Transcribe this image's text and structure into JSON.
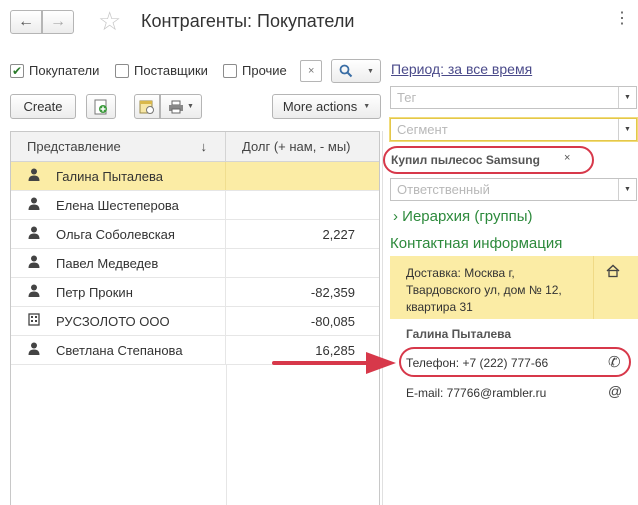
{
  "header": {
    "back_icon": "arrow-left-icon",
    "forward_icon": "arrow-right-icon",
    "star_icon": "star-icon",
    "title": "Контрагенты: Покупатели",
    "more_icon": "more-menu-icon"
  },
  "filters": {
    "buyers": {
      "label": "Покупатели",
      "checked": true
    },
    "suppliers": {
      "label": "Поставщики",
      "checked": false
    },
    "other": {
      "label": "Прочие",
      "checked": false
    },
    "clear_glyph": "×"
  },
  "toolbar": {
    "create_label": "Create",
    "more_actions_label": "More actions"
  },
  "table": {
    "columns": [
      "Представление",
      "Долг (+ нам, - мы)"
    ],
    "sort_glyph": "↓",
    "rows": [
      {
        "type": "person",
        "name": "Галина Пыталева",
        "debt": "",
        "selected": true
      },
      {
        "type": "person",
        "name": "Елена Шестеперова",
        "debt": ""
      },
      {
        "type": "person",
        "name": "Ольга Соболевская",
        "debt": "2,227"
      },
      {
        "type": "person",
        "name": "Павел Медведев",
        "debt": ""
      },
      {
        "type": "person",
        "name": "Петр Прокин",
        "debt": "-82,359"
      },
      {
        "type": "company",
        "name": "РУСЗОЛОТО ООО",
        "debt": "-80,085"
      },
      {
        "type": "person",
        "name": "Светлана Степанова",
        "debt": "16,285"
      }
    ]
  },
  "panel": {
    "period": "Период: за все время",
    "tag_placeholder": "Тег",
    "segment_placeholder": "Сегмент",
    "selected_tag": "Купил пылесос Samsung",
    "tag_remove": "×",
    "responsible_placeholder": "Ответственный",
    "hierarchy": "Иерархия (группы)",
    "hierarchy_chevron": "›",
    "contacts_title": "Контактная информация",
    "address": "Доставка: Москва г, Твардовского ул, дом № 12, квартира 31",
    "contact_name": "Галина Пыталева",
    "phone": "Телефон: +7 (222) 777-66",
    "email": "E-mail: 77766@rambler.ru",
    "at_glyph": "@"
  },
  "colors": {
    "selection": "#fbeca5",
    "accent_green": "#2d8a3c",
    "highlight_red": "#d7384a"
  }
}
